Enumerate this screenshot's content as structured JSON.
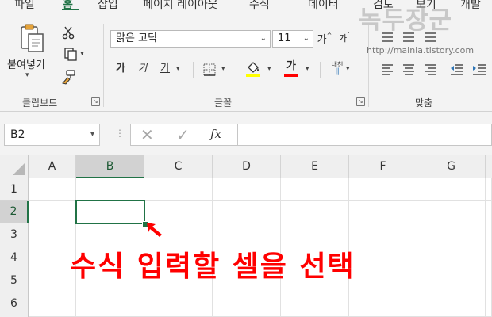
{
  "ribbon": {
    "tabs": [
      {
        "label": "파일"
      },
      {
        "label": "홈"
      },
      {
        "label": "삽입"
      },
      {
        "label": "페이지 레이아웃"
      },
      {
        "label": "수식"
      },
      {
        "label": "데이터"
      },
      {
        "label": "검토"
      },
      {
        "label": "보기"
      },
      {
        "label": "개발"
      }
    ],
    "clipboard": {
      "paste_label": "붙여넣기",
      "group_label": "클립보드"
    },
    "font": {
      "font_name": "맑은 고딕",
      "font_size": "11",
      "grow_label": "가",
      "shrink_label": "가",
      "bold_label": "가",
      "italic_label": "가",
      "underline_label": "가",
      "font_color_label": "가",
      "phonetic_label": "내천",
      "group_label": "글꼴",
      "highlight_color": "#ffff00",
      "font_color": "#ff0000"
    },
    "alignment": {
      "group_label": "맞춤"
    }
  },
  "watermark": {
    "title": "녹두장군",
    "url": "http://mainia.tistory.com"
  },
  "formula_bar": {
    "name_box": "B2",
    "fx_label": "fx",
    "formula": ""
  },
  "sheet": {
    "columns": [
      "A",
      "B",
      "C",
      "D",
      "E",
      "F",
      "G"
    ],
    "rows": [
      "1",
      "2",
      "3",
      "4",
      "5",
      "6"
    ],
    "selected_cell": "B2",
    "accent_color": "#217346"
  },
  "annotation": {
    "text": "수식 입력할 셀을 선택",
    "color": "#ff0000"
  }
}
